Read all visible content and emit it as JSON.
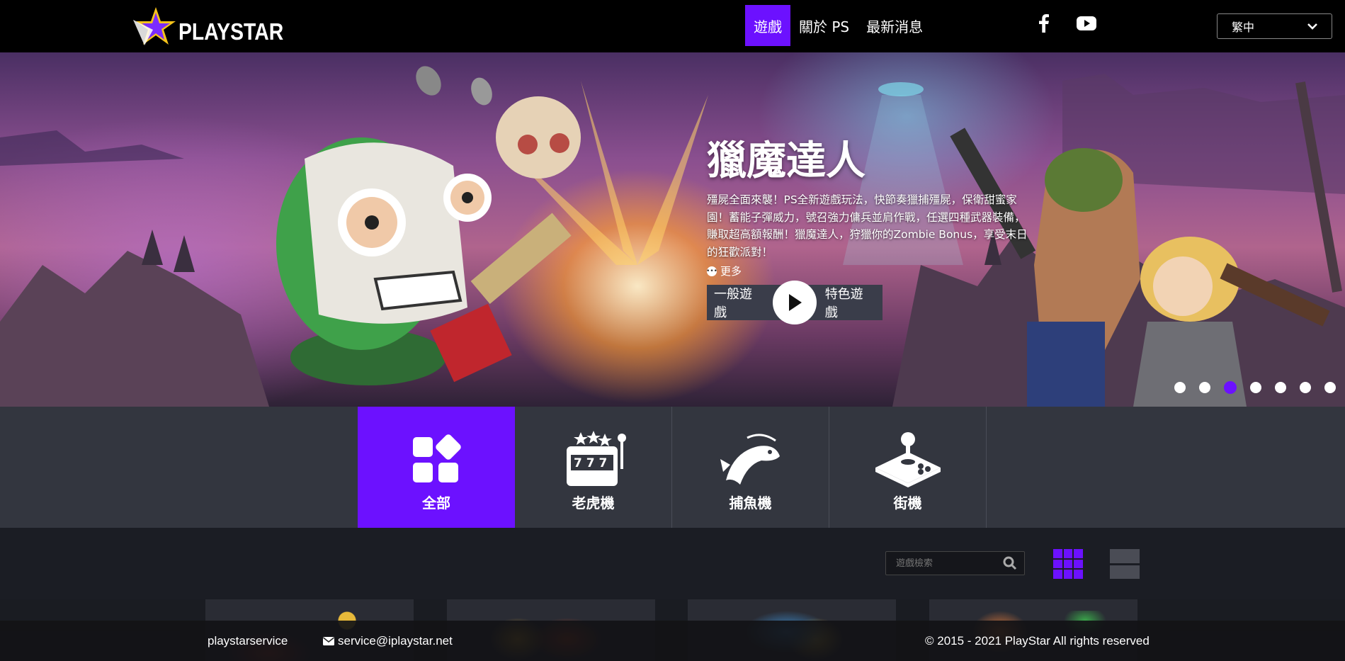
{
  "brand": {
    "name": "PLAYSTAR",
    "accent": "#6c11ff"
  },
  "nav": {
    "items": [
      {
        "label": "遊戲",
        "active": true
      },
      {
        "label": "關於 PS",
        "active": false
      },
      {
        "label": "最新消息",
        "active": false
      }
    ]
  },
  "social": {
    "facebook": "facebook-icon",
    "youtube": "youtube-icon"
  },
  "language": {
    "selected": "繁中"
  },
  "hero": {
    "title": "獵魔達人",
    "description": "殭屍全面來襲！PS全新遊戲玩法，快節奏獵捕殭屍，保衛甜蜜家園！蓄能子彈威力，號召強力傭兵並肩作戰，任選四種武器裝備，賺取超高額報酬！獵魔達人，狩獵你的Zombie Bonus，享受末日的狂歡派對！",
    "more_label": "更多",
    "play_normal_label": "一般遊戲",
    "play_feature_label": "特色遊戲",
    "slides_total": 7,
    "slide_active_index": 2
  },
  "categories": [
    {
      "label": "全部",
      "icon": "grid-apps-icon",
      "active": true
    },
    {
      "label": "老虎機",
      "icon": "slot-machine-icon",
      "active": false
    },
    {
      "label": "捕魚機",
      "icon": "fish-icon",
      "active": false
    },
    {
      "label": "街機",
      "icon": "arcade-joystick-icon",
      "active": false
    }
  ],
  "toolbar": {
    "search_placeholder": "遊戲檢索",
    "view_mode": "grid"
  },
  "footer": {
    "service_id": "playstarservice",
    "email": "service@iplaystar.net",
    "copyright": "© 2015 - 2021 PlayStar All rights reserved"
  }
}
